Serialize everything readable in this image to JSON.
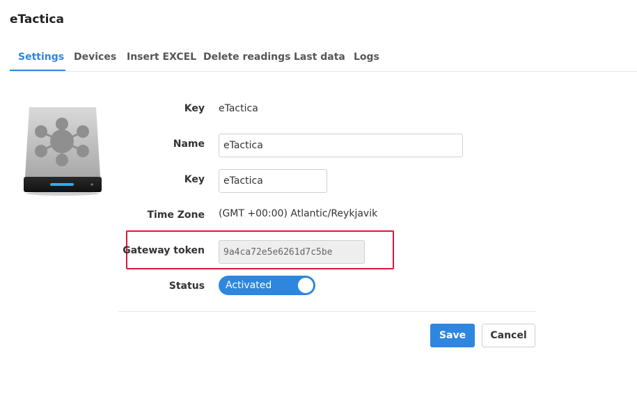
{
  "app": {
    "title": "eTactica"
  },
  "tabs": [
    {
      "label": "Settings",
      "active": true
    },
    {
      "label": "Devices"
    },
    {
      "label": "Insert EXCEL"
    },
    {
      "label": "Delete readings"
    },
    {
      "label": "Last data"
    },
    {
      "label": "Logs"
    }
  ],
  "form": {
    "key_display": {
      "label": "Key",
      "value": "eTactica"
    },
    "name": {
      "label": "Name",
      "value": "eTactica"
    },
    "key_input": {
      "label": "Key",
      "value": "eTactica"
    },
    "timezone": {
      "label": "Time Zone",
      "value": "(GMT +00:00) Atlantic/Reykjavik"
    },
    "gateway_token": {
      "label": "Gateway token",
      "value": "9a4ca72e5e6261d7c5be"
    },
    "status": {
      "label": "Status",
      "value": "Activated",
      "on": true
    }
  },
  "buttons": {
    "save": "Save",
    "cancel": "Cancel"
  },
  "colors": {
    "accent": "#2e86de",
    "highlight": "#d9163c"
  },
  "icons": {
    "device": "hard-drive-network-icon"
  }
}
